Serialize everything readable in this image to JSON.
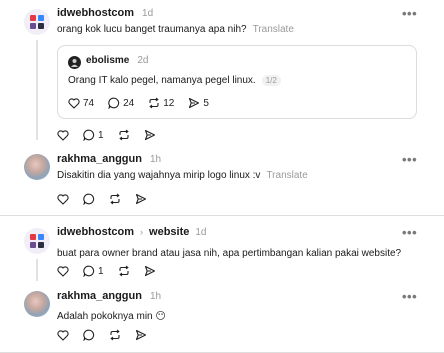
{
  "posts": [
    {
      "username": "idwebhostcom",
      "time": "1d",
      "text": "orang kok lucu banget traumanya apa nih?",
      "translate": "Translate",
      "actions": {
        "reply_count": "1"
      },
      "quote": {
        "username": "ebolisme",
        "time": "2d",
        "text": "Orang IT kalo pegel, namanya pegel linux.",
        "page": "1/2",
        "likes": "74",
        "comments": "24",
        "reposts": "12",
        "shares": "5"
      }
    },
    {
      "username": "rakhma_anggun",
      "time": "1h",
      "text": "Disakitin dia yang wajahnya mirip logo linux :v",
      "translate": "Translate"
    },
    {
      "username": "idwebhostcom",
      "reply_to": "website",
      "time": "1d",
      "text": "buat para owner brand atau jasa nih, apa pertimbangan kalian pakai website?",
      "actions": {
        "reply_count": "1"
      }
    },
    {
      "username": "rakhma_anggun",
      "time": "1h",
      "text": "Adalah pokoknya min 😶"
    }
  ],
  "more_glyph": "•••",
  "colors": {
    "muted": "#9a9a9a",
    "divider": "#dedede",
    "thread_line": "#e2e2e2"
  }
}
